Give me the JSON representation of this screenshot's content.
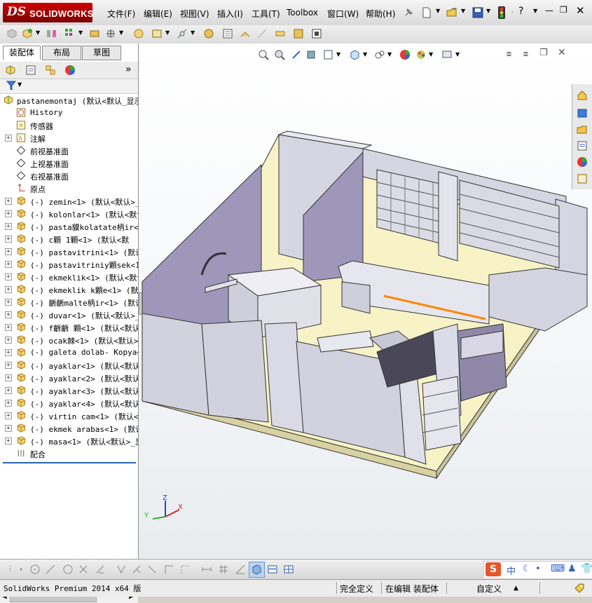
{
  "app": {
    "logo_ds": "DS",
    "logo_text": "SOLIDWORKS"
  },
  "menu": [
    "文件(F)",
    "编辑(E)",
    "视图(V)",
    "插入(I)",
    "工具(T)",
    "Toolbox",
    "窗口(W)",
    "帮助(H)"
  ],
  "help_mark": "?",
  "panel_tabs": [
    "装配体",
    "布局",
    "草图"
  ],
  "tree": {
    "root": "pastanemontaj  (默认<默认_显示",
    "items": [
      {
        "label": "History",
        "icon": "history-icon",
        "expandable": false
      },
      {
        "label": "传感器",
        "icon": "sensor-icon",
        "expandable": false
      },
      {
        "label": "注解",
        "icon": "annotation-icon",
        "expandable": true
      },
      {
        "label": "前视基准面",
        "icon": "plane-icon",
        "expandable": false
      },
      {
        "label": "上视基准面",
        "icon": "plane-icon",
        "expandable": false
      },
      {
        "label": "右视基准面",
        "icon": "plane-icon",
        "expandable": false
      },
      {
        "label": "原点",
        "icon": "origin-icon",
        "expandable": false
      },
      {
        "label": "(-) zemin<1> (默认<默认>_",
        "icon": "part-icon",
        "expandable": true
      },
      {
        "label": "(-) kolonlar<1> (默认<默认",
        "icon": "part-icon",
        "expandable": true
      },
      {
        "label": "(-) pasta貘kolatate柄ir<1",
        "icon": "part-icon",
        "expandable": true
      },
      {
        "label": "(-) c顆  1顆<1> (默认<默",
        "icon": "part-icon",
        "expandable": true
      },
      {
        "label": "(-) pastavitrini<1> (默认",
        "icon": "part-icon",
        "expandable": true
      },
      {
        "label": "(-) pastavitriniy顆sek<1>",
        "icon": "part-icon",
        "expandable": true
      },
      {
        "label": "(-) ekmeklik<1> (默认<默认",
        "icon": "part-icon",
        "expandable": true
      },
      {
        "label": "(-) ekmeklik k顆e<1> (默认",
        "icon": "part-icon",
        "expandable": true
      },
      {
        "label": "(-) 齭齭malte柄ir<1> (默认",
        "icon": "part-icon",
        "expandable": true
      },
      {
        "label": "(-) duvar<1> (默认<默认>_",
        "icon": "part-icon",
        "expandable": true
      },
      {
        "label": "(-) f齭齭 顆<1> (默认<默认",
        "icon": "part-icon",
        "expandable": true
      },
      {
        "label": "(-) ocak棘<1> (默认<默认>",
        "icon": "part-icon",
        "expandable": true
      },
      {
        "label": "(-) galeta dolab- Kopya<1",
        "icon": "part-icon",
        "expandable": true
      },
      {
        "label": "(-) ayaklar<1> (默认<默认",
        "icon": "part-icon",
        "expandable": true
      },
      {
        "label": "(-) ayaklar<2> (默认<默认",
        "icon": "part-icon",
        "expandable": true
      },
      {
        "label": "(-) ayaklar<3> (默认<默认",
        "icon": "part-icon",
        "expandable": true
      },
      {
        "label": "(-) ayaklar<4> (默认<默认",
        "icon": "part-icon",
        "expandable": true
      },
      {
        "label": "(-) virtin cam<1> (默认<",
        "icon": "part-icon",
        "expandable": true
      },
      {
        "label": "(-) ekmek arabas<1> (默认",
        "icon": "part-icon",
        "expandable": true
      },
      {
        "label": "(-) masa<1> (默认<默认>_显",
        "icon": "part-icon",
        "expandable": true
      },
      {
        "label": "配合",
        "icon": "mate-icon",
        "expandable": false
      }
    ]
  },
  "triad": {
    "x": "X",
    "y": "Y",
    "z": "Z"
  },
  "ime": {
    "lang": "中"
  },
  "status": {
    "product": "SolidWorks Premium 2014 x64 版",
    "state1": "完全定义",
    "state2": "在编辑 装配体",
    "state3": "自定义",
    "state3_arrow": "▲"
  },
  "colors": {
    "accent": "#c00000",
    "floor": "#f7f3c6",
    "wall_side": "#9f97b9",
    "wall_face": "#d6d6e2",
    "highlight_edge": "#ff8800"
  }
}
